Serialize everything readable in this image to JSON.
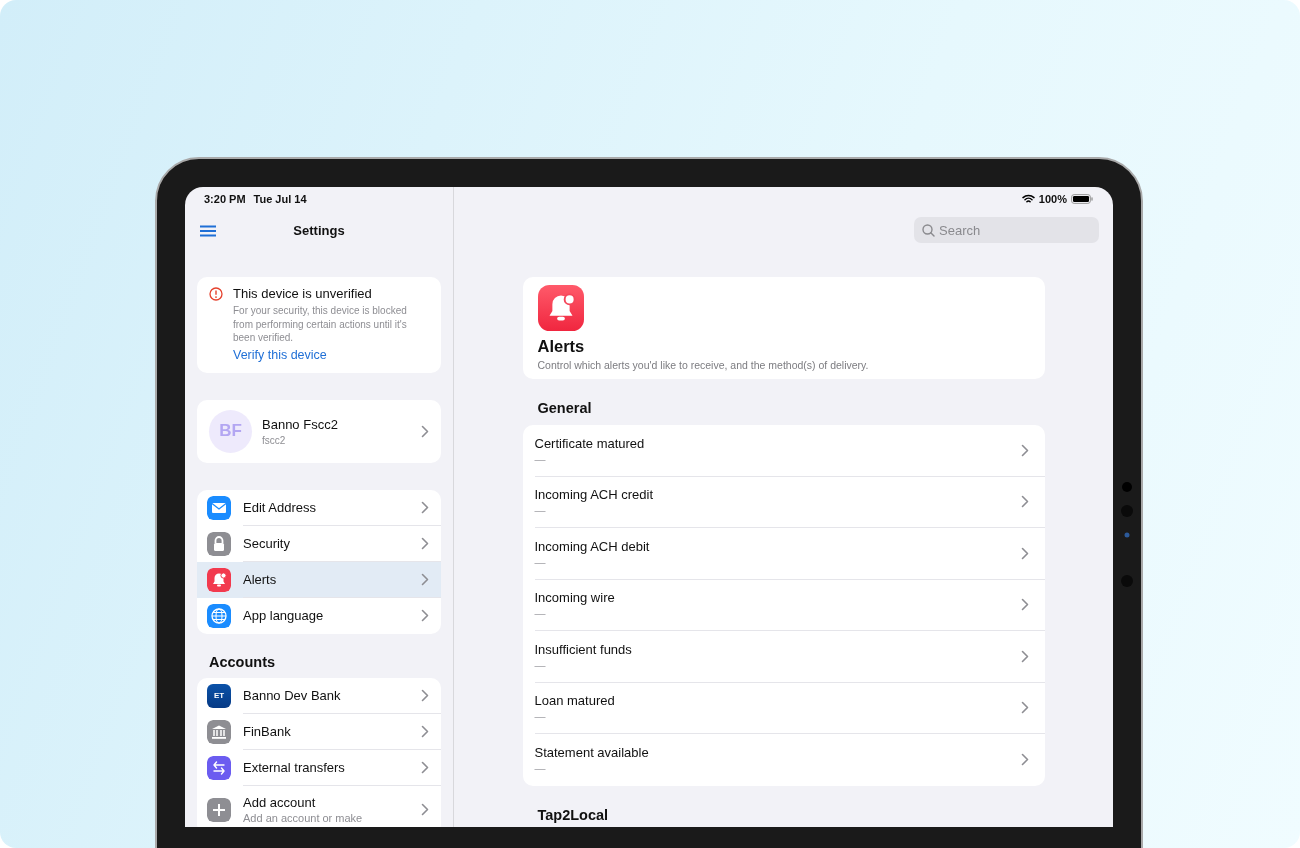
{
  "status_bar": {
    "time": "3:20 PM",
    "date": "Tue Jul 14",
    "battery": "100%"
  },
  "sidebar": {
    "title": "Settings",
    "warning": {
      "title": "This device is unverified",
      "message": "For your security, this device is blocked from performing certain actions until it's been verified.",
      "link": "Verify this device"
    },
    "profile": {
      "initials": "BF",
      "name": "Banno Fscc2",
      "username": "fscc2"
    },
    "menu": [
      {
        "label": "Edit Address",
        "kind": "mail",
        "selected": false
      },
      {
        "label": "Security",
        "kind": "lock",
        "selected": false
      },
      {
        "label": "Alerts",
        "kind": "bell",
        "selected": true
      },
      {
        "label": "App language",
        "kind": "globe",
        "selected": false
      }
    ],
    "accounts_header": "Accounts",
    "accounts": [
      {
        "label": "Banno Dev Bank",
        "kind": "logo",
        "logo_text": "ET"
      },
      {
        "label": "FinBank",
        "kind": "bank"
      },
      {
        "label": "External transfers",
        "kind": "transfer"
      },
      {
        "label": "Add account",
        "subtitle": "Add an account or make",
        "kind": "add"
      }
    ]
  },
  "main": {
    "search": {
      "placeholder": "Search"
    },
    "header": {
      "title": "Alerts",
      "description": "Control which alerts you'd like to receive, and the method(s) of delivery."
    },
    "sections": [
      {
        "title": "General",
        "items": [
          {
            "label": "Certificate matured",
            "value": "—"
          },
          {
            "label": "Incoming ACH credit",
            "value": "—"
          },
          {
            "label": "Incoming ACH debit",
            "value": "—"
          },
          {
            "label": "Incoming wire",
            "value": "—"
          },
          {
            "label": "Insufficient funds",
            "value": "—"
          },
          {
            "label": "Loan matured",
            "value": "—"
          },
          {
            "label": "Statement available",
            "value": "—"
          }
        ]
      },
      {
        "title": "Tap2Local"
      }
    ]
  }
}
